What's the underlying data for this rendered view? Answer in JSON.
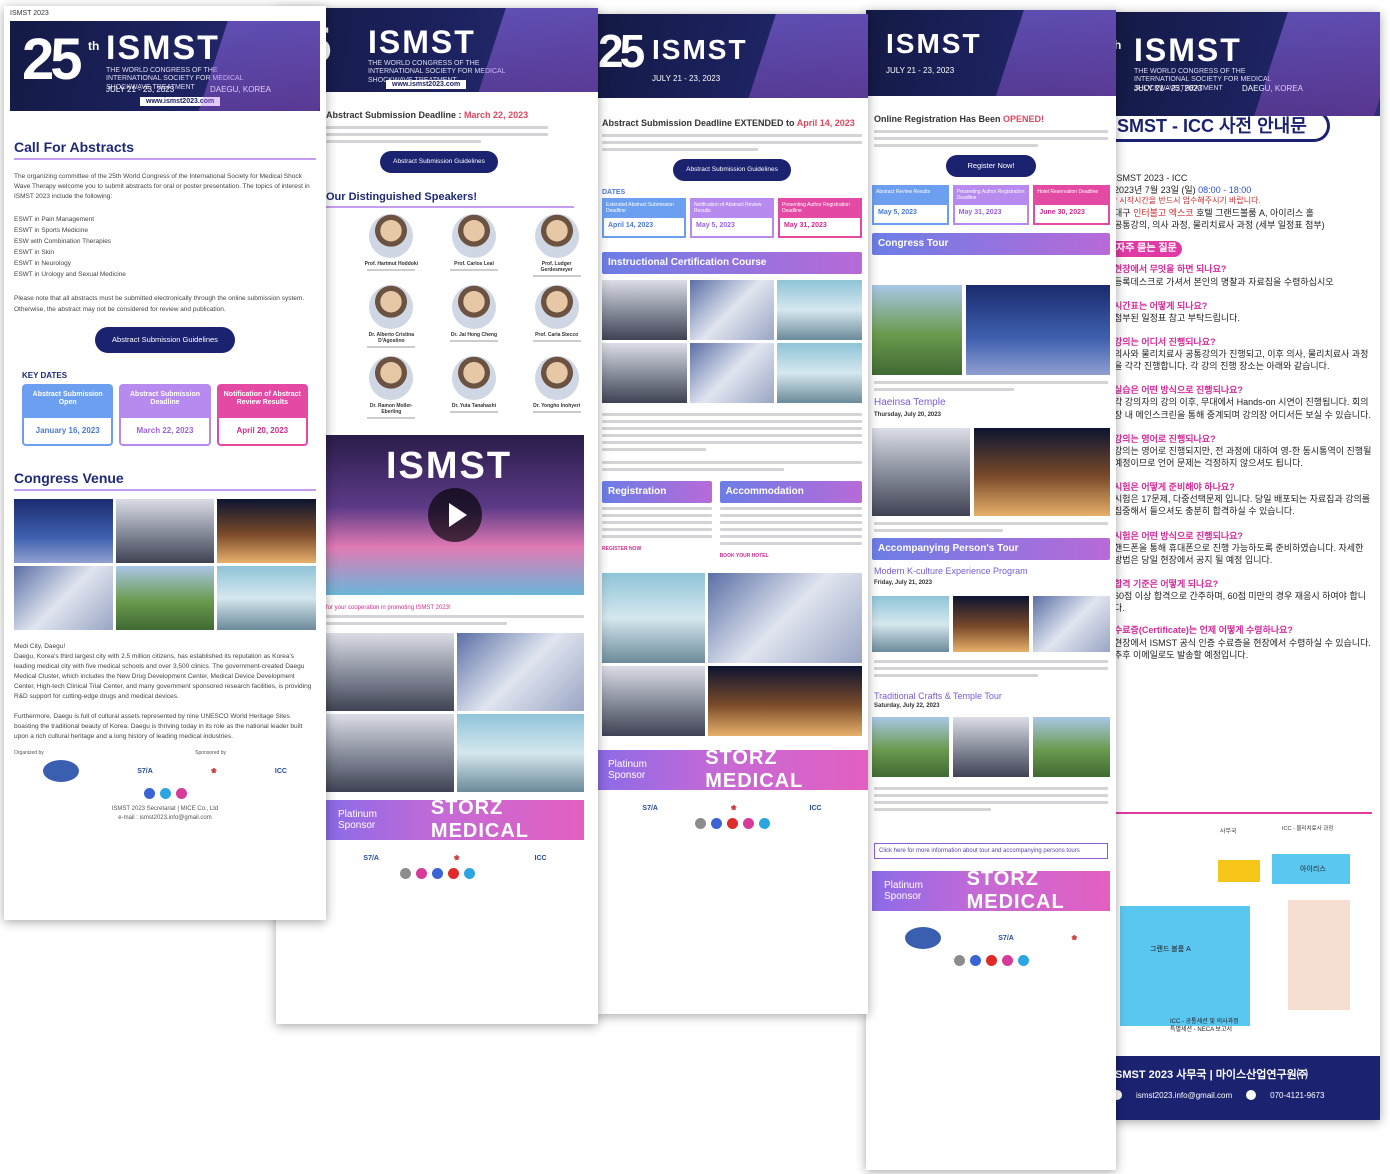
{
  "banner": {
    "number": "25",
    "ordinal": "th",
    "logo": "ISMST",
    "subtitle": "THE WORLD CONGRESS OF THE INTERNATIONAL SOCIETY FOR MEDICAL SHOCKWAVE TREATMENT",
    "dates": "JULY 21 - 23, 2023",
    "city": "DAEGU, KOREA",
    "url": "www.ismst2023.com"
  },
  "s1": {
    "tag": "ISMST 2023",
    "call_title": "Call For Abstracts",
    "intro": "The organizing committee of the 25th World Congress of the International Society for Medical Shock Wave Therapy welcome you to submit abstracts for oral or poster presentation. The topics of interest in ISMST 2023 include the following:",
    "topics": [
      "ESWT in Pain Management",
      "ESWT in Sports Medicine",
      "ESW with Combination Therapies",
      "ESWT in Skin",
      "ESWT in Neurology",
      "ESWT in Urology and Sexual Medicine"
    ],
    "note": "Please note that all abstracts must be submitted electronically through the online submission system. Otherwise, the abstract may not be considered for review and publication.",
    "guidelines_button": "Abstract Submission Guidelines",
    "key_dates_title": "KEY DATES",
    "key_dates": [
      {
        "label": "Abstract Submission Open",
        "date": "January 16, 2023",
        "color": "#6c9ff0"
      },
      {
        "label": "Abstract Submission Deadline",
        "date": "March 22, 2023",
        "color": "#b78af0"
      },
      {
        "label": "Notification of Abstract Review Results",
        "date": "April 20, 2023",
        "color": "#e44aa3"
      }
    ],
    "venue_title": "Congress Venue",
    "venue_name": "Medi City, Daegu!",
    "venue_p1": "Daegu, Korea's third largest city with 2.5 million citizens, has established its reputation as Korea's leading medical city with five medical schools and over 3,500 clinics. The government-created Daegu Medical Cluster, which includes the New Drug Development Center, Medical Device Development Center, High-tech Clinical Trial Center, and many government sponsored research facilities, is providing R&D support for cutting-edge drugs and medical devices.",
    "venue_p2": "Furthermore, Daegu is full of cultural assets represented by nine UNESCO World Heritage Sites boasting the traditional beauty of Korea. Daegu is thriving today in its role as the national leader built upon a rich cultural heritage and a long history of leading medical industries.",
    "organized_by": "Organized by",
    "sponsored_by": "Sponsored by",
    "secretariat": "ISMST 2023 Secretariat | MICE Co., Ltd",
    "email": "e-mail : ismst2023.info@gmail.com"
  },
  "s2": {
    "deadline_label": "Abstract Submission Deadline :",
    "deadline_date": "March 22, 2023",
    "guidelines_button": "Abstract Submission Guidelines",
    "speakers_title": "Our Distinguished Speakers!",
    "speakers_row1": [
      "Prof. Hartmut Hoddoki",
      "Prof. Carlos Leal",
      "Prof. Ludger Gerdesmeyer"
    ],
    "speakers_row2": [
      "Dr. Alberto Cristina D'Agostino",
      "Dr. Jai Hong Cheng",
      "Prof. Carla Stecco"
    ],
    "speakers_row3": [
      "Dr. Ramon Moller-Eberling",
      "Dr. Yuta Tanahashi",
      "Dr. Yongho Inohyeri"
    ],
    "video_logo": "ISMST",
    "cooperation": "for your cooperation in promoting ISMST 2023!",
    "sponsor_label": "Platinum Sponsor",
    "sponsor_name": "STORZ MEDICAL"
  },
  "s3": {
    "deadline_label": "Abstract Submission Deadline EXTENDED to",
    "deadline_date": "April 14, 2023",
    "guidelines_button": "Abstract Submission Guidelines",
    "dates_title": "DATES",
    "dates": [
      {
        "label": "Extended Abstract Submission Deadline",
        "date": "April 14, 2023"
      },
      {
        "label": "Notification of Abstract Review Results",
        "date": "May 5, 2023"
      },
      {
        "label": "Presenting Author Registration Deadline",
        "date": "May 31, 2023"
      }
    ],
    "icc_bar": "Instructional Certification Course",
    "registration_bar": "Registration",
    "accommodation_bar": "Accommodation",
    "register_now": "REGISTER NOW",
    "book_hotel": "BOOK YOUR HOTEL",
    "sponsor_label": "Platinum Sponsor",
    "sponsor_name": "STORZ MEDICAL"
  },
  "s4": {
    "reg_open_label": "Online Registration Has Been",
    "reg_open_status": "OPENED!",
    "register_button": "Register Now!",
    "dates": [
      {
        "label": "Abstract Review Results",
        "date": "May 5, 2023"
      },
      {
        "label": "Presenting Author Registration Deadline",
        "date": "May 31, 2023"
      },
      {
        "label": "Hotel Reservation Deadline",
        "date": "June 30, 2023"
      }
    ],
    "tour_bar": "Congress Tour",
    "haeinsa": "Haeinsa Temple",
    "haeinsa_date": "Thursday, July 20, 2023",
    "accompanying_bar": "Accompanying Person's Tour",
    "kculture": "Modern K-culture Experience Program",
    "kculture_date": "Friday, July 21, 2023",
    "crafts": "Traditional Crafts & Temple Tour",
    "crafts_date": "Saturday, July 22, 2023",
    "more_link": "Click here for more information about tour and accompanying persons tours",
    "sponsor_label": "Platinum Sponsor",
    "sponsor_name": "STORZ MEDICAL"
  },
  "s5": {
    "title": "ISMST - ICC 사전 안내문",
    "line1": "ISMST 2023 - ICC",
    "line2_pre": "2023년 7월 23일 (일)",
    "line2_time": "08:00 - 18:00",
    "line3": "* 시작시간을 반드시 엄수해주시기 바랍니다.",
    "line4_pre": "대구",
    "line4_hl": "인터불고 엑스코",
    "line4_post": "호텔 그랜드볼룸 A, 아이리스 홀",
    "line5": "공통강의, 의사 과정, 물리치료사 과정 (세부 일정표 첨부)",
    "faq_title": "자주 묻는 질문",
    "faq": [
      {
        "q": "현장에서 무엇을 하면 되나요?",
        "a": "등록데스크로 가셔서 본인의 명찰과 자료집을 수령하십시오"
      },
      {
        "q": "시간표는 어떻게 되나요?",
        "a": "첨부된 일정표 참고 부탁드립니다."
      },
      {
        "q": "강의는 어디서 진행되나요?",
        "a": "의사와 물리치료사 공통강의가 진행되고, 이후 의사, 물리치료사 과정을 각각 진행합니다. 각 강의 진행 장소는 아래와 같습니다."
      },
      {
        "q": "실습은 어떤 방식으로 진행되나요?",
        "a": "각 강의자의 강의 이후, 무대에서 Hands-on 시연이 진행됩니다. 회의장 내 메인스크린을 통해 중계되며 강의장 어디서든 보실 수 있습니다."
      },
      {
        "q": "강의는 영어로 진행되나요?",
        "a": "강의는 영어로 진행되지만, 전 과정에 대하여 영-한 동시통역이 진행될 예정이므로 언어 문제는 걱정하지 않으셔도 됩니다."
      },
      {
        "q": "시험은 어떻게 준비해야 하나요?",
        "a": "시험은 17문제, 다중선택문제 입니다. 당일 배포되는 자료집과 강의를 집중해서 들으셔도 충분히 합격하실 수 있습니다."
      },
      {
        "q": "시험은 어떤 방식으로 진행되나요?",
        "a": "핸드폰을 통해 휴대폰으로 진행 가능하도록 준비하였습니다. 자세한 방법은 당일 현장에서 공지 될 예정 입니다."
      },
      {
        "q": "합격 기준은 어떻게 되나요?",
        "a": "60점 이상 합격으로 간주하며, 60점 미만의 경우 재응시 하여야 합니다."
      },
      {
        "q": "수료증(Certificate)는 언제 어떻게 수령하나요?",
        "a": "현장에서 ISMST 공식 인증 수료증을 현장에서 수령하실 수 있습니다. 추후 이메일로도 발송할 예정입니다."
      }
    ],
    "map_office": "사무국",
    "map_hall_a": "그랜드 볼룸 A",
    "map_iris": "아이리스",
    "map_legend1": "ICC - 공통세션 및 의사과정",
    "map_legend2": "특별세션 - NECA 보고서",
    "map_note": "ICC - 물리치료사 과정",
    "footer_title": "ISMST 2023 사무국 | 마이스산업연구원㈜",
    "footer_email": "ismst2023.info@gmail.com",
    "footer_phone": "070-4121-9673"
  }
}
